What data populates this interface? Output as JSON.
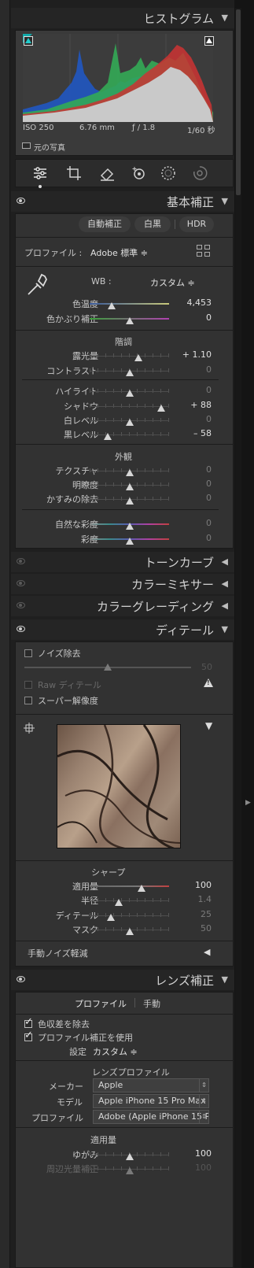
{
  "histogram": {
    "title": "ヒストグラム",
    "iso": "ISO 250",
    "focal": "6.76 mm",
    "aperture": "ƒ / 1.8",
    "shutter": "1/60 秒",
    "original_photo": "元の写真"
  },
  "tools": [
    "edit-sliders-icon",
    "crop-icon",
    "healing-eraser-icon",
    "redeye-icon",
    "masking-icon",
    "presets-icon"
  ],
  "basic": {
    "title": "基本補正",
    "auto": "自動補正",
    "bw": "白黒",
    "hdr": "HDR",
    "profile_label": "プロファイル :",
    "profile_value": "Adobe 標準 ≑",
    "wb_label": "WB :",
    "wb_value": "カスタム ≑",
    "temp_label": "色温度",
    "temp_value": "4,453",
    "temp_pos": 0.28,
    "tint_label": "色かぶり補正",
    "tint_value": "0",
    "tint_pos": 0.5,
    "tone_label": "階調",
    "exposure_label": "露光量",
    "exposure_value": "+ 1.10",
    "exposure_pos": 0.61,
    "contrast_label": "コントラスト",
    "contrast_value": "0",
    "contrast_pos": 0.5,
    "highlights_label": "ハイライト",
    "highlights_value": "0",
    "highlights_pos": 0.5,
    "shadows_label": "シャドウ",
    "shadows_value": "+ 88",
    "shadows_pos": 0.9,
    "whites_label": "白レベル",
    "whites_value": "0",
    "whites_pos": 0.5,
    "blacks_label": "黒レベル",
    "blacks_value": "– 58",
    "blacks_pos": 0.23,
    "presence_label": "外観",
    "texture_label": "テクスチャ",
    "texture_value": "0",
    "texture_pos": 0.5,
    "clarity_label": "明瞭度",
    "clarity_value": "0",
    "clarity_pos": 0.5,
    "dehaze_label": "かすみの除去",
    "dehaze_value": "0",
    "dehaze_pos": 0.5,
    "vibrance_label": "自然な彩度",
    "vibrance_value": "0",
    "vibrance_pos": 0.5,
    "saturation_label": "彩度",
    "saturation_value": "0",
    "saturation_pos": 0.5
  },
  "panels": {
    "tone_curve": "トーンカーブ",
    "color_mixer": "カラーミキサー",
    "color_grading": "カラーグレーディング"
  },
  "detail": {
    "title": "ディテール",
    "noise_label": "ノイズ除去",
    "noise_value": "50",
    "noise_pos": 0.5,
    "raw_detail": "Raw ディテール",
    "super_res": "スーパー解像度",
    "sharpen_label": "シャープ",
    "amount_label": "適用量",
    "amount_value": "100",
    "amount_pos": 0.65,
    "radius_label": "半径",
    "radius_value": "1.4",
    "radius_pos": 0.37,
    "detail_label": "ディテール",
    "detail_value": "25",
    "detail_pos": 0.27,
    "masking_label": "マスク",
    "masking_value": "50",
    "masking_pos": 0.5,
    "manual_noise": "手動ノイズ軽減"
  },
  "lens": {
    "title": "レンズ補正",
    "tab_profile": "プロファイル",
    "tab_manual": "手動",
    "remove_ca": "色収差を除去",
    "use_profile": "プロファイル補正を使用",
    "setup_label": "設定",
    "setup_value": "カスタム ≑",
    "lens_profile_label": "レンズプロファイル",
    "make_label": "メーカー",
    "make_value": "Apple",
    "model_label": "モデル",
    "model_value": "Apple iPhone 15 Pro Max ba...",
    "profile_label": "プロファイル",
    "profile_value": "Adobe (Apple iPhone 15 Pro...",
    "amount_label": "適用量",
    "distortion_label": "ゆがみ",
    "distortion_value": "100",
    "distortion_pos": 0.5,
    "vignetting_label": "周辺光量補正",
    "vignetting_value": "100",
    "vignetting_pos": 0.5
  }
}
